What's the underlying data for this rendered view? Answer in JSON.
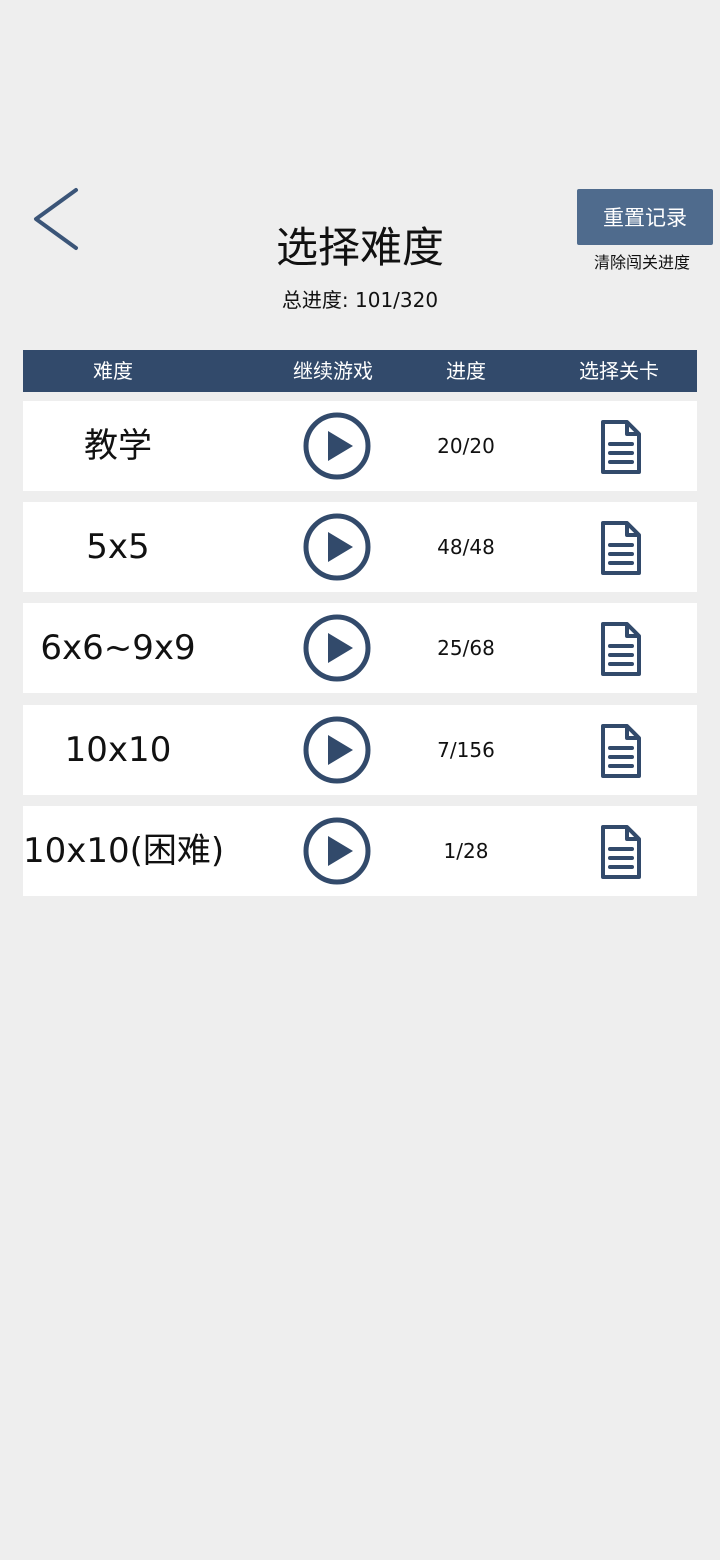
{
  "header": {
    "title": "选择难度",
    "total_progress": "总进度: 101/320",
    "reset_button_label": "重置记录",
    "reset_caption": "清除闯关进度"
  },
  "table": {
    "columns": [
      "难度",
      "继续游戏",
      "进度",
      "选择关卡"
    ],
    "rows": [
      {
        "difficulty": "教学",
        "progress": "20/20"
      },
      {
        "difficulty": "5x5",
        "progress": "48/48"
      },
      {
        "difficulty": "6x6~9x9",
        "progress": "25/68"
      },
      {
        "difficulty": "10x10",
        "progress": "7/156"
      },
      {
        "difficulty": "10x10(困难)",
        "progress": "1/28"
      }
    ]
  },
  "icons": {
    "back": "chevron-left-icon",
    "play": "play-circle-icon",
    "select": "document-icon"
  },
  "colors": {
    "accent": "#324a6b",
    "button": "#4f6b8d",
    "background": "#eeeeee",
    "row": "#ffffff"
  }
}
